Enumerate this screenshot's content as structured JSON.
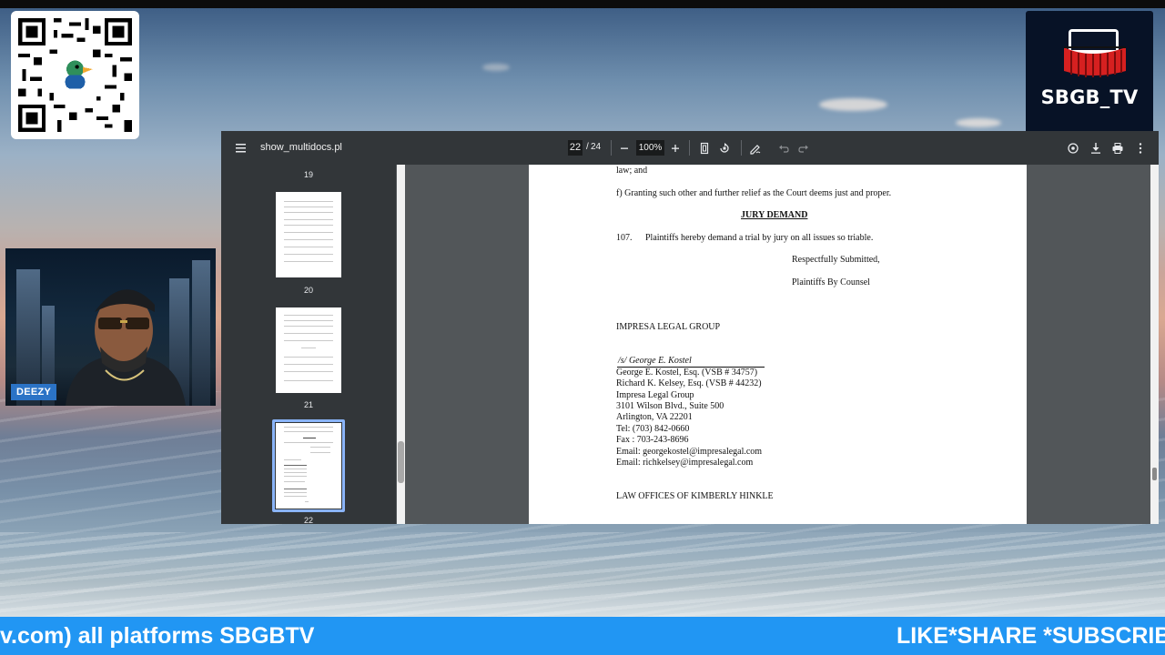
{
  "overlay": {
    "logo_text": "SBGB_TV",
    "webcam_name": "DEEZY",
    "ticker_left": "v.com) all platforms SBGBTV",
    "ticker_right": "LIKE*SHARE *SUBSCRIBE"
  },
  "viewer": {
    "filename": "show_multidocs.pl",
    "current_page": "22",
    "page_separator": "/",
    "total_pages": "24",
    "zoom": "100%",
    "thumbnails": [
      {
        "label": "19"
      },
      {
        "label": "20"
      },
      {
        "label": "21"
      },
      {
        "label": "22",
        "selected": true
      }
    ]
  },
  "document": {
    "line1": "law; and",
    "line2": "f) Granting such other and further relief as the Court deems just and proper.",
    "heading": "JURY DEMAND",
    "para_num": "107.",
    "para_text": "Plaintiffs hereby demand a trial by jury on all issues so triable.",
    "closing1": "Respectfully Submitted,",
    "closing2": "Plaintiffs By Counsel",
    "firm1": "IMPRESA LEGAL GROUP",
    "signature": "/s/ George E. Kostel",
    "contact": [
      "George E. Kostel, Esq. (VSB # 34757)",
      "Richard K. Kelsey, Esq. (VSB # 44232)",
      "Impresa Legal Group",
      "3101 Wilson Blvd., Suite 500",
      "Arlington, VA 22201",
      "Tel: (703) 842-0660",
      "Fax : 703-243-8696",
      "Email:  georgekostel@impresalegal.com",
      "Email:  richkelsey@impresalegal.com"
    ],
    "firm2": "LAW OFFICES OF KIMBERLY HINKLE"
  },
  "colors": {
    "toolbar": "#323639",
    "ticker": "#2196f3",
    "selection": "#8ab4f8"
  }
}
